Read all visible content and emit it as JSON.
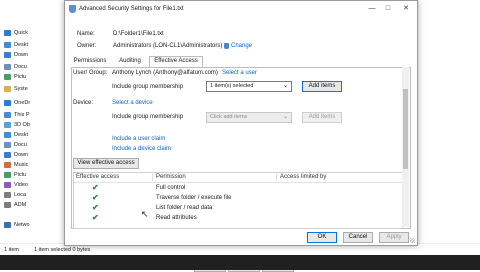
{
  "explorer": {
    "sidebar": [
      {
        "label": "Quick",
        "color": "#2b7cd3"
      },
      {
        "label": "Deskt",
        "color": "#3c8dde"
      },
      {
        "label": "Down",
        "color": "#3a7dd0"
      },
      {
        "label": "Docu",
        "color": "#6b8fbf"
      },
      {
        "label": "Pictu",
        "color": "#4a9a6b"
      },
      {
        "label": "Syste",
        "color": "#d8b24a"
      },
      {
        "label": "OneDr",
        "color": "#2b7cd3"
      },
      {
        "label": "This P",
        "color": "#4a8ad4"
      },
      {
        "label": "3D Ob",
        "color": "#5aa0d8"
      },
      {
        "label": "Deskt",
        "color": "#3c8dde"
      },
      {
        "label": "Docu",
        "color": "#6b8fbf"
      },
      {
        "label": "Down",
        "color": "#3a7dd0"
      },
      {
        "label": "Music",
        "color": "#d86a3a"
      },
      {
        "label": "Pictu",
        "color": "#4a9a6b"
      },
      {
        "label": "Video",
        "color": "#8a5ac8"
      },
      {
        "label": "Loca",
        "color": "#7d7d7d"
      },
      {
        "label": "ADM",
        "color": "#7d7d7d"
      },
      {
        "label": "Netwo",
        "color": "#3b6fb5"
      }
    ],
    "status": {
      "items": "1 item",
      "selected": "1 item selected  0 bytes"
    }
  },
  "dialog": {
    "title": "Advanced Security Settings for File1.txt",
    "name_label": "Name:",
    "name_value": "D:\\Folder1\\File1.txt",
    "owner_label": "Owner:",
    "owner_value": "Administrators (LON-CL1\\Administrators)",
    "change_label": "Change",
    "tabs": [
      "Permissions",
      "Auditing",
      "Effective Access"
    ],
    "active_tab": "Effective Access",
    "user_group_label": "User/ Group:",
    "user_group_value": "Anthony Lynch (Anthony@alfatum.com)",
    "select_user_label": "Select a user",
    "include_group_label": "Include group membership",
    "user_group_select": "1 item(s) selected",
    "add_items_label": "Add items",
    "device_label": "Device:",
    "select_device_label": "Select a device",
    "device_group_label": "Include group membership",
    "device_select": "Click add items",
    "device_add_items_label": "Add items",
    "include_user_claim": "Include a user claim",
    "include_device_claim": "Include a device claim",
    "view_effective_label": "View effective access",
    "table": {
      "headers": [
        "Effective access",
        "Permission",
        "Access limited by"
      ],
      "rows": [
        {
          "permission": "Full control"
        },
        {
          "permission": "Traverse folder / execute file"
        },
        {
          "permission": "List folder / read data"
        },
        {
          "permission": "Read attributes"
        }
      ]
    },
    "buttons": {
      "ok": "OK",
      "cancel": "Cancel",
      "apply": "Apply"
    }
  },
  "back_dialog_buttons": {
    "ok": "OK",
    "cancel": "Cancel",
    "apply": "Apply"
  }
}
